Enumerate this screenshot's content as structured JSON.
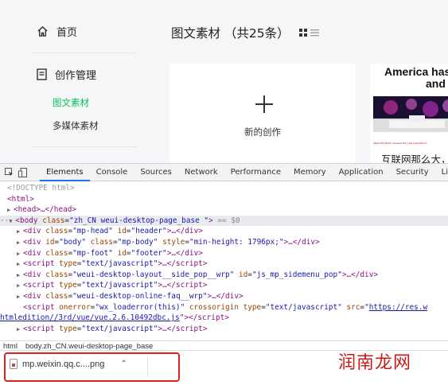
{
  "sidebar": {
    "home_label": "首页",
    "group_label": "创作管理",
    "items": [
      {
        "label": "图文素材",
        "active": true
      },
      {
        "label": "多媒体素材",
        "active": false
      }
    ]
  },
  "main": {
    "title": "图文素材 （共25条）",
    "new_card_label": "新的创作",
    "article": {
      "thumb_title_line1": "America has",
      "thumb_title_line2": "and",
      "thumb_caption": "ANALYSIS Biden showed the vast potential to",
      "title": "互联网那么大，"
    }
  },
  "devtools": {
    "tabs": [
      "Elements",
      "Console",
      "Sources",
      "Network",
      "Performance",
      "Memory",
      "Application",
      "Security",
      "Li"
    ],
    "active_tab": "Elements",
    "dom": {
      "doctype": "<!DOCTYPE html>",
      "html_open": "<html>",
      "head": "<head>…</head>",
      "body_tag": "<body",
      "body_attr": "class",
      "body_val": "\"zh_CN weui-desktop-page_base \"",
      "body_close": ">",
      "body_eq": "== $0",
      "div1_attr": "class",
      "div1_val": "\"mp-head\"",
      "div1_attr2": "id",
      "div1_val2": "\"header\"",
      "div2_attr": "id",
      "div2_val": "\"body\"",
      "div2_attr2": "class",
      "div2_val2": "\"mp-body\"",
      "div2_attr3": "style",
      "div2_val3": "\"min-height: 1796px;\"",
      "div3_attr": "class",
      "div3_val": "\"mp-foot\"",
      "div3_attr2": "id",
      "div3_val2": "\"footer\"",
      "script_attr": "type",
      "script_val": "\"text/javascript\"",
      "div4_attr": "class",
      "div4_val": "\"weui-desktop-layout__side_pop__wrp\"",
      "div4_attr2": "id",
      "div4_val2": "\"js_mp_sidemenu_pop\"",
      "div5_attr": "class",
      "div5_val": "\"weui-desktop-online-faq__wrp\"",
      "script2_attr1": "onerror",
      "script2_val1": "\"wx_loaderror(this)\"",
      "script2_attr2": "crossorigin",
      "script2_attr3": "type",
      "script2_val3": "\"text/javascript\"",
      "script2_attr4": "src",
      "script2_link1": "https://res.w",
      "script2_link2": "htmledition//3rd/vue/vue.2.6.10492dbc.js"
    },
    "breadcrumbs": [
      "html",
      "body.zh_CN.weui-desktop-page_base"
    ]
  },
  "download": {
    "filename": "mp.weixin.qq.c....png"
  },
  "watermark": "润南龙网"
}
